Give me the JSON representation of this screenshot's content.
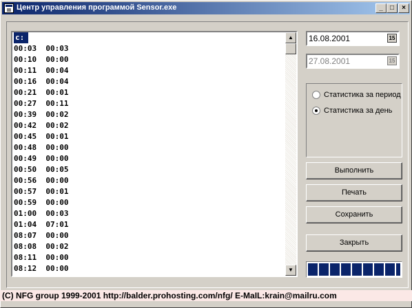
{
  "window": {
    "title": "Центр управления программой Sensor.exe",
    "minimize_glyph": "_",
    "maximize_glyph": "□",
    "close_glyph": "×"
  },
  "list": {
    "rows": [
      "c:",
      "00:03  00:03",
      "00:10  00:00",
      "00:11  00:04",
      "00:16  00:04",
      "00:21  00:01",
      "00:27  00:11",
      "00:39  00:02",
      "00:42  00:02",
      "00:45  00:01",
      "00:48  00:00",
      "00:49  00:00",
      "00:50  00:05",
      "00:56  00:00",
      "00:57  00:01",
      "00:59  00:00",
      "01:00  00:03",
      "01:04  07:01",
      "08:07  00:00",
      "08:08  00:02",
      "08:11  00:00",
      "08:12  00:00"
    ],
    "selected_index": 0,
    "scroll_up_glyph": "▲",
    "scroll_down_glyph": "▼"
  },
  "dates": {
    "start": "16.08.2001",
    "end": "27.08.2001",
    "calendar_glyph": "15"
  },
  "mode": {
    "period_label": "Статистика за период",
    "day_label": "Статистика за день",
    "selected": "day"
  },
  "buttons": {
    "run": "Выполнить",
    "print": "Печать",
    "save": "Сохранить",
    "close": "Закрыть"
  },
  "progress": {
    "value_pct": 100
  },
  "status": {
    "text": "(C) NFG group 1999-2001 http://balder.prohosting.com/nfg/  E-MaIL:krain@mailru.com"
  },
  "colors": {
    "titlebar_start": "#0a246a",
    "titlebar_end": "#a6caf0",
    "selection": "#0a246a",
    "status_bg": "#fbe8e6"
  }
}
